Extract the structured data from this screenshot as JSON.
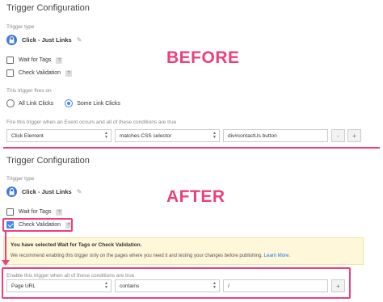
{
  "before": {
    "section_title": "Trigger Configuration",
    "trigger_type_label": "Trigger type",
    "trigger_type_name": "Click - Just Links",
    "wait_for_tags": "Wait for Tags",
    "check_validation": "Check Validation",
    "fires_on_label": "This trigger fires on",
    "radio_all": "All Link Clicks",
    "radio_some": "Some Link Clicks",
    "condition_label": "Fire this trigger when an Event occurs and all of these conditions are true",
    "condition_variable": "Click Element",
    "condition_operator": "matches CSS selector",
    "condition_value": "div#contactUs button",
    "minus_label": "-",
    "plus_label": "+"
  },
  "after": {
    "section_title": "Trigger Configuration",
    "trigger_type_label": "Trigger type",
    "trigger_type_name": "Click - Just Links",
    "wait_for_tags": "Wait for Tags",
    "check_validation": "Check Validation",
    "warning_title": "You have selected Wait for Tags or Check Validation.",
    "warning_text": "We recommend enabling this trigger only on the pages where you need it and testing your changes before publishing.",
    "warning_link": "Learn More.",
    "enable_label": "Enable this trigger when all of these conditions are true",
    "condition_variable": "Page URL",
    "condition_operator": "contains",
    "condition_value": "/",
    "plus_label": "+"
  },
  "annotations": {
    "before_label": "BEFORE",
    "after_label": "AFTER",
    "accent_color": "#ec407a"
  },
  "icons": {
    "help": "?",
    "pencil": "✎",
    "select_arrows": "▲▼"
  }
}
